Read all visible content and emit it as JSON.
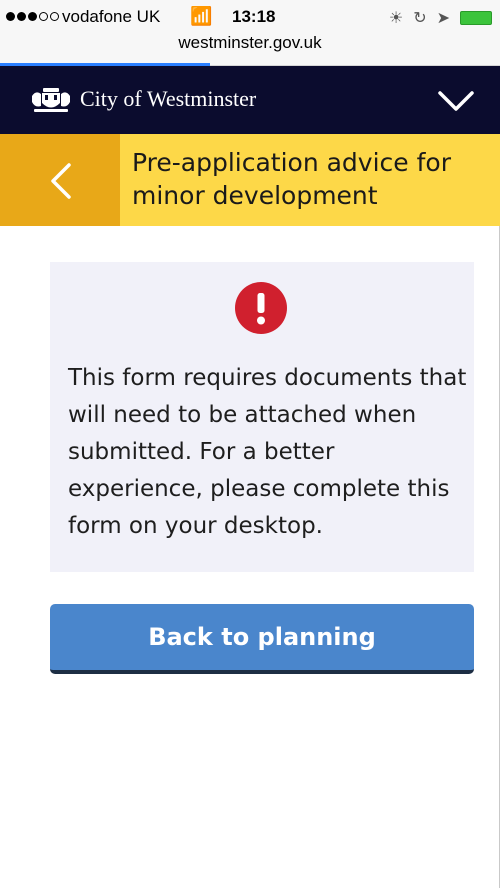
{
  "status_bar": {
    "carrier": "vodafone UK",
    "time": "13:18",
    "url": "westminster.gov.uk"
  },
  "header": {
    "brand": "City of Westminster"
  },
  "title_bar": {
    "title": "Pre-application advice for minor development"
  },
  "notice": {
    "message": "This form requires documents that will need to be attached when submitted. For a better experience, please complete this form on your desktop."
  },
  "actions": {
    "back_to_planning_label": "Back to planning"
  },
  "colors": {
    "header_navy": "#0b0c2e",
    "title_yellow": "#fdd848",
    "back_tab_amber": "#e8a818",
    "alert_red": "#d0202e",
    "button_blue": "#4a86cc"
  },
  "icons": {
    "alert": "exclamation-circle-icon",
    "back": "chevron-left-icon",
    "menu": "chevron-down-icon",
    "crest": "crest-logo"
  }
}
